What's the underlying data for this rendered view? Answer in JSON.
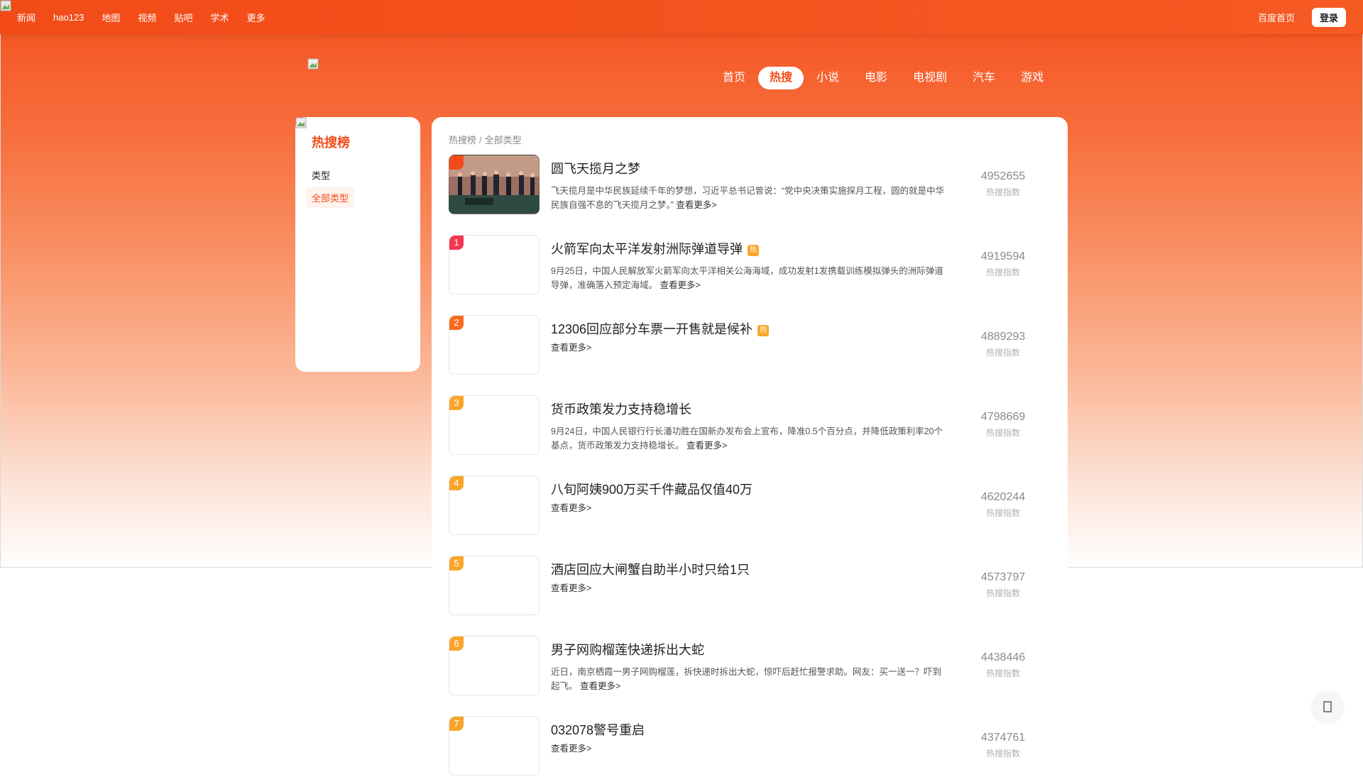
{
  "topbar": {
    "left_links": [
      "新闻",
      "hao123",
      "地图",
      "视频",
      "贴吧",
      "学术",
      "更多"
    ],
    "home_link": "百度首页",
    "login_label": "登录"
  },
  "channel_tabs": [
    "首页",
    "热搜",
    "小说",
    "电影",
    "电视剧",
    "汽车",
    "游戏"
  ],
  "active_tab": "热搜",
  "sidebar": {
    "title": "热搜榜",
    "type_label": "类型",
    "type_chip": "全部类型"
  },
  "breadcrumb": [
    "热搜榜",
    "全部类型"
  ],
  "breadcrumb_sep": "/",
  "more_label": "查看更多>",
  "score_label": "热搜指数",
  "hot_tag": "热",
  "items": [
    {
      "rank": "",
      "title": "圆飞天揽月之梦",
      "hot": false,
      "desc": "飞天揽月是中华民族延续千年的梦想，习近平总书记曾说：“党中央决策实施探月工程，圆的就是中华民族自强不息的飞天揽月之梦。”",
      "score": "4952655",
      "badge_color": "#f24b18"
    },
    {
      "rank": "1",
      "title": "火箭军向太平洋发射洲际弹道导弹",
      "hot": true,
      "desc": "9月25日，中国人民解放军火箭军向太平洋相关公海海域，成功发射1发携载训练模拟弹头的洲际弹道导弹，准确落入预定海域。",
      "score": "4919594",
      "badge_color": "#f4354e"
    },
    {
      "rank": "2",
      "title": "12306回应部分车票一开售就是候补",
      "hot": true,
      "desc": "",
      "score": "4889293",
      "badge_color": "#f96a1e"
    },
    {
      "rank": "3",
      "title": "货币政策发力支持稳增长",
      "hot": false,
      "desc": "9月24日，中国人民银行行长潘功胜在国新办发布会上宣布，降准0.5个百分点，并降低政策利率20个基点，货币政策发力支持稳增长。",
      "score": "4798669",
      "badge_color": "#f9a52b"
    },
    {
      "rank": "4",
      "title": "八旬阿姨900万买千件藏品仅值40万",
      "hot": false,
      "desc": "",
      "score": "4620244",
      "badge_color": "#f9a52b"
    },
    {
      "rank": "5",
      "title": "酒店回应大闸蟹自助半小时只给1只",
      "hot": false,
      "desc": "",
      "score": "4573797",
      "badge_color": "#f9a52b"
    },
    {
      "rank": "6",
      "title": "男子网购榴莲快递拆出大蛇",
      "hot": false,
      "desc": "近日，南京栖霞一男子网购榴莲，拆快递时拆出大蛇，惊吓后赶忙报警求助。网友：买一送一？吓到起飞。",
      "score": "4438446",
      "badge_color": "#f9a52b"
    },
    {
      "rank": "7",
      "title": "032078警号重启",
      "hot": false,
      "desc": "",
      "score": "4374761",
      "badge_color": "#f9a52b"
    }
  ],
  "float_button_icon": "feedback-icon"
}
